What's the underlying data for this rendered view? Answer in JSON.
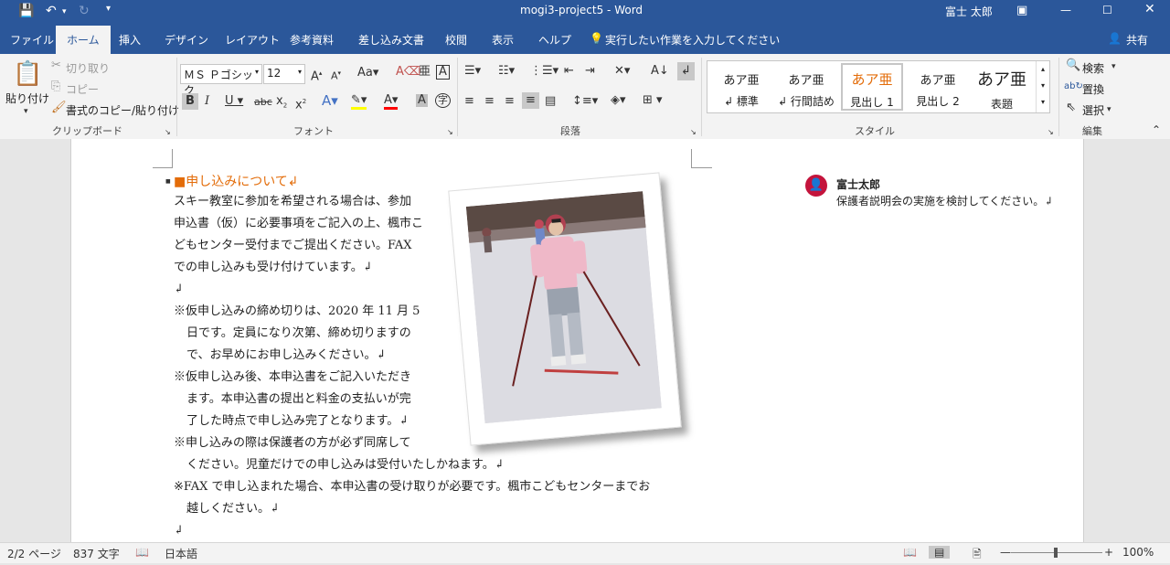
{
  "titlebar": {
    "title": "mogi3-project5  -  Word",
    "user": "富士 太郎"
  },
  "tabs": [
    "ファイル",
    "ホーム",
    "挿入",
    "デザイン",
    "レイアウト",
    "参考資料",
    "差し込み文書",
    "校閲",
    "表示",
    "ヘルプ"
  ],
  "tell_me": "実行したい作業を入力してください",
  "share": "共有",
  "clipboard": {
    "paste": "貼り付け",
    "cut": "切り取り",
    "copy": "コピー",
    "format_painter": "書式のコピー/貼り付け",
    "label": "クリップボード"
  },
  "font": {
    "name": "ＭＳ Ｐゴシック",
    "size": "12",
    "label": "フォント"
  },
  "paragraph": {
    "label": "段落"
  },
  "styles": {
    "label": "スタイル",
    "items": [
      {
        "preview": "あア亜",
        "name": "↲ 標準"
      },
      {
        "preview": "あア亜",
        "name": "↲ 行間詰め"
      },
      {
        "preview": "あア亜",
        "name": "見出し 1"
      },
      {
        "preview": "あア亜",
        "name": "見出し 2"
      },
      {
        "preview": "あア亜",
        "name": "表題"
      }
    ]
  },
  "editing": {
    "find": "検索",
    "replace": "置換",
    "select": "選択",
    "label": "編集"
  },
  "document": {
    "heading": "■申し込みについて↲",
    "lines": [
      "スキー教室に参加を希望される場合は、参加",
      "申込書（仮）に必要事項をご記入の上、楓市こ",
      "どもセンター受付までご提出ください。FAX",
      "での申し込みも受け付けています。↲",
      "↲",
      "※仮申し込みの締め切りは、2020 年 11 月 5",
      "日です。定員になり次第、締め切りますの",
      "で、お早めにお申し込みください。↲",
      "※仮申し込み後、本申込書をご記入いただき",
      "ます。本申込書の提出と料金の支払いが完",
      "了した時点で申し込み完了となります。↲",
      "※申し込みの際は保護者の方が必ず同席して",
      "ください。児童だけでの申し込みは受付いたしかねます。↲",
      "※FAX で申し込まれた場合、本申込書の受け取りが必要です。楓市こどもセンターまでお",
      "越しください。↲",
      "↲"
    ]
  },
  "comment": {
    "author": "富士太郎",
    "text": "保護者説明会の実施を検討してください。↲"
  },
  "status": {
    "page": "2/2 ページ",
    "words": "837 文字",
    "language": "日本語",
    "zoom": "100%"
  }
}
